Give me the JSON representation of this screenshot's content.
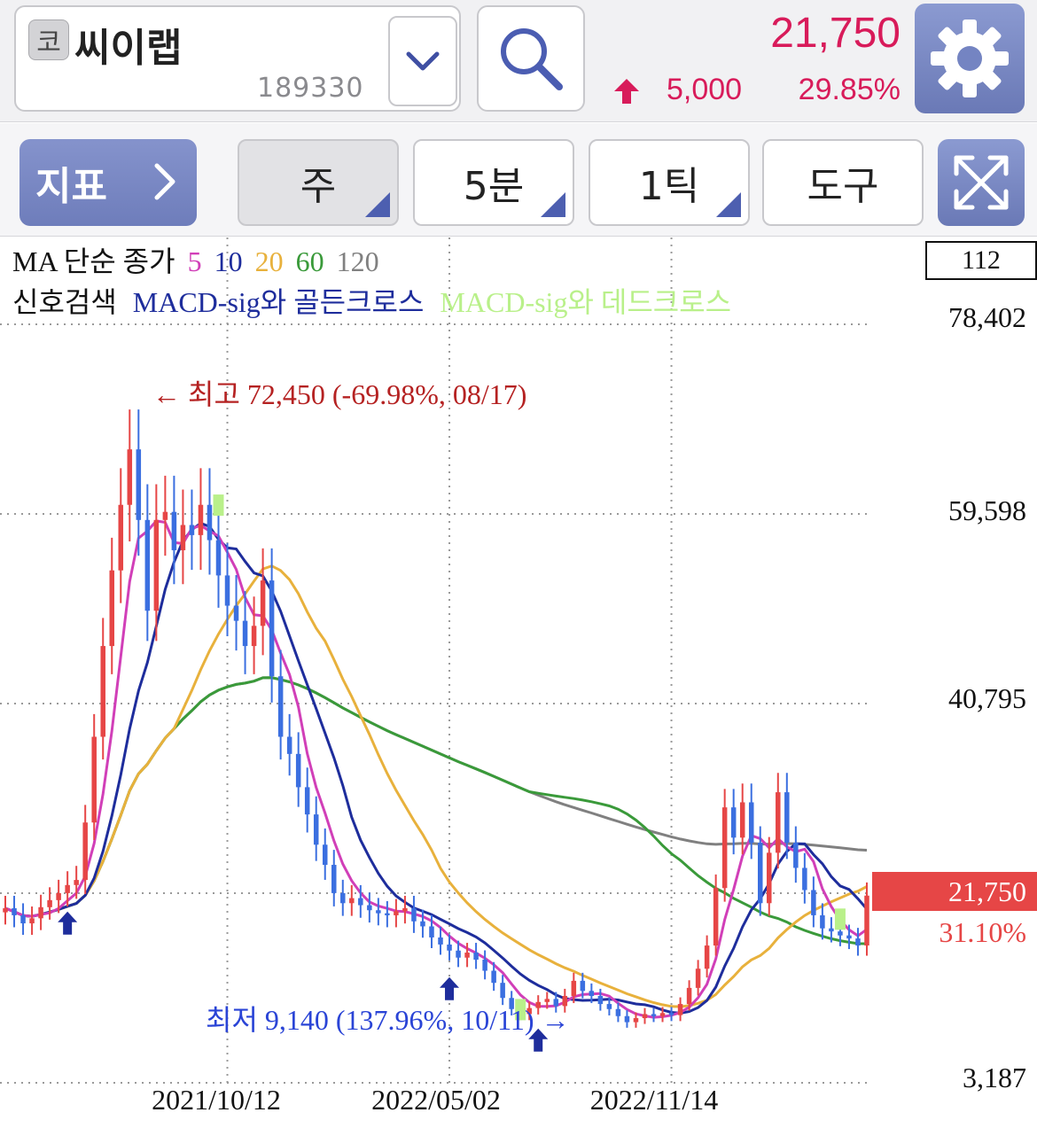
{
  "header": {
    "market_badge": "코",
    "stock_name": "씨이랩",
    "stock_code": "189330",
    "price": "21,750",
    "change": "5,000",
    "change_pct": "29.85%",
    "colors": {
      "up": "#d81b5a",
      "accent": "#7484c2"
    }
  },
  "toolbar": {
    "indicator_label": "지표",
    "buttons": [
      {
        "label": "주",
        "active": true
      },
      {
        "label": "5분",
        "active": false
      },
      {
        "label": "1틱",
        "active": false
      },
      {
        "label": "도구",
        "active": false
      }
    ],
    "icons": [
      "chevron-right-icon",
      "expand-icon"
    ]
  },
  "legend": {
    "ma_title": "MA 단순 종가",
    "ma_periods": [
      {
        "label": "5",
        "color": "#d13fb8"
      },
      {
        "label": "10",
        "color": "#1e2d9c"
      },
      {
        "label": "20",
        "color": "#e8b13c"
      },
      {
        "label": "60",
        "color": "#3a9a3a"
      },
      {
        "label": "120",
        "color": "#808080"
      }
    ],
    "signal_title": "신호검색",
    "signal_golden": "MACD-sig와 골든크로스",
    "signal_dead": "MACD-sig와 데드크로스",
    "candle_count": "112"
  },
  "chart_data": {
    "type": "candlestick",
    "y_tick_labels": [
      "78,402",
      "59,598",
      "40,795",
      "3,187"
    ],
    "y_ticks": [
      78402,
      59598,
      40795,
      21990,
      3187
    ],
    "x_tick_labels": [
      "2021/10/12",
      "2022/05/02",
      "2022/11/14"
    ],
    "x_tick_index": [
      25,
      50,
      75
    ],
    "last_price_label": "21,750",
    "last_price_pct": "31.10%",
    "high_annotation": "최고 72,450 (-69.98%, 08/17)",
    "low_annotation": "최저 9,140 (137.96%, 10/11)",
    "colors": {
      "up": "#e64646",
      "down": "#3b6fe0",
      "golden_arrow": "#1e2d9c",
      "dead_marker": "#b9f08a"
    },
    "closes": [
      20500,
      19800,
      19000,
      19500,
      20600,
      21300,
      22000,
      22800,
      23300,
      29000,
      37500,
      46500,
      54000,
      60500,
      66000,
      59000,
      50000,
      59000,
      59800,
      56000,
      58500,
      57500,
      60500,
      57000,
      53500,
      50500,
      49000,
      46500,
      48500,
      53000,
      43500,
      37500,
      35800,
      32500,
      29800,
      26800,
      24800,
      22000,
      21000,
      21500,
      20800,
      20300,
      20000,
      19800,
      20200,
      20500,
      19200,
      18700,
      17600,
      16900,
      16300,
      15600,
      16100,
      15400,
      14300,
      13100,
      11600,
      10500,
      10000,
      10600,
      11200,
      11500,
      10800,
      11800,
      13300,
      12300,
      11800,
      11000,
      10500,
      9800,
      9200,
      9600,
      10000,
      9800,
      10100,
      9900,
      11000,
      12600,
      14500,
      16800,
      22500,
      30500,
      27500,
      31000,
      27000,
      21000,
      26000,
      32000,
      27000,
      24500,
      22300,
      19800,
      18500,
      18200,
      17800,
      17500,
      16800,
      21750
    ]
  }
}
